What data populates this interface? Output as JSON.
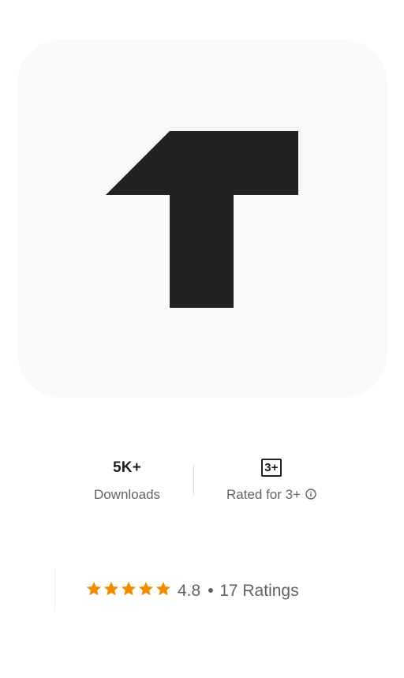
{
  "app": {
    "icon_name": "t-logo-icon",
    "icon_color": "#222222",
    "card_color": "#f9f9f9"
  },
  "stats": {
    "downloads_value": "5K+",
    "downloads_label": "Downloads",
    "content_rating_badge": "3+",
    "content_rating_label": "Rated for 3+"
  },
  "ratings": {
    "stars": 5,
    "star_color": "#f28b00",
    "score": "4.8",
    "count_label": "17 Ratings"
  }
}
